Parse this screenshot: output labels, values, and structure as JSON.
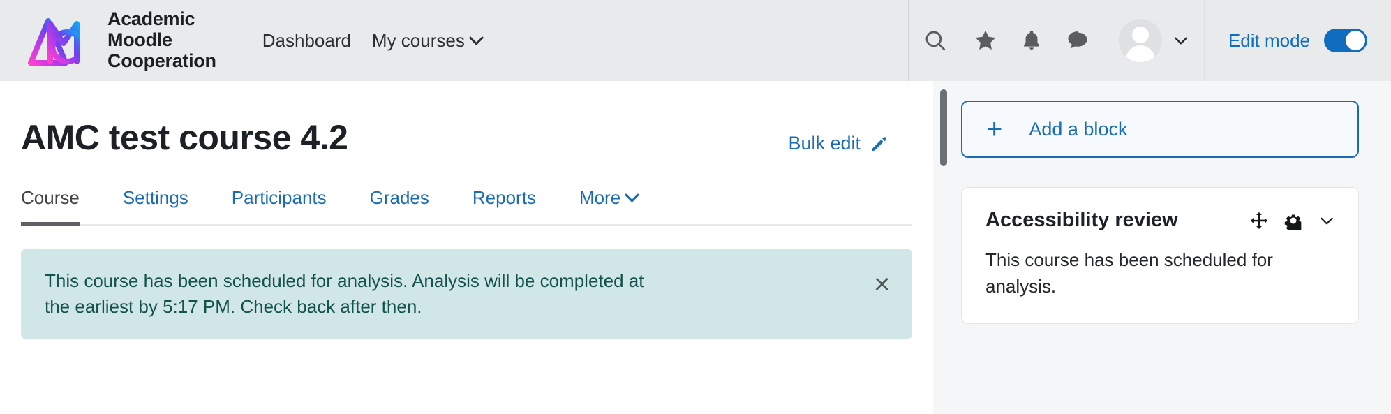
{
  "header": {
    "brand": {
      "logo_icon": "amc-logo-icon",
      "line1": "Academic",
      "line2": "Moodle",
      "line3": "Cooperation",
      "gradient_from": "#ff47d0",
      "gradient_mid": "#8a2be2",
      "gradient_to": "#109cf1"
    },
    "nav": [
      {
        "label": "Dashboard",
        "has_chevron": false
      },
      {
        "label": "My courses",
        "has_chevron": true
      }
    ],
    "icons": [
      {
        "name": "search-icon",
        "title": "Search"
      },
      {
        "name": "star-icon",
        "title": "Favourites"
      },
      {
        "name": "bell-icon",
        "title": "Notifications"
      },
      {
        "name": "message-icon",
        "title": "Messages"
      }
    ],
    "avatar": {
      "name": "avatar",
      "has_chevron": true
    },
    "edit_mode": {
      "label": "Edit mode",
      "enabled": true,
      "accent": "#0f6cbf"
    }
  },
  "main": {
    "page_title": "AMC test course 4.2",
    "bulk_edit": {
      "label": "Bulk edit",
      "icon": "pencil-icon"
    },
    "tabs": [
      {
        "label": "Course",
        "active": true,
        "has_chevron": false
      },
      {
        "label": "Settings",
        "active": false,
        "has_chevron": false
      },
      {
        "label": "Participants",
        "active": false,
        "has_chevron": false
      },
      {
        "label": "Grades",
        "active": false,
        "has_chevron": false
      },
      {
        "label": "Reports",
        "active": false,
        "has_chevron": false
      },
      {
        "label": "More",
        "active": false,
        "has_chevron": true
      }
    ],
    "alert": {
      "text": "This course has been scheduled for analysis. Analysis will be completed at the earliest by 5:17 PM. Check back after then.",
      "close_label": "×",
      "bg": "#d1e7e7",
      "fg": "#14524e"
    }
  },
  "sidebar": {
    "add_block": {
      "label": "Add a block",
      "plus": "+",
      "accent": "#1c6cb5"
    },
    "block": {
      "title": "Accessibility review",
      "body": "This course has been scheduled for analysis.",
      "actions": [
        {
          "name": "move-icon",
          "title": "Move"
        },
        {
          "name": "gear-icon",
          "title": "Actions"
        },
        {
          "name": "chevron-down-icon",
          "title": "Collapse"
        }
      ]
    }
  }
}
